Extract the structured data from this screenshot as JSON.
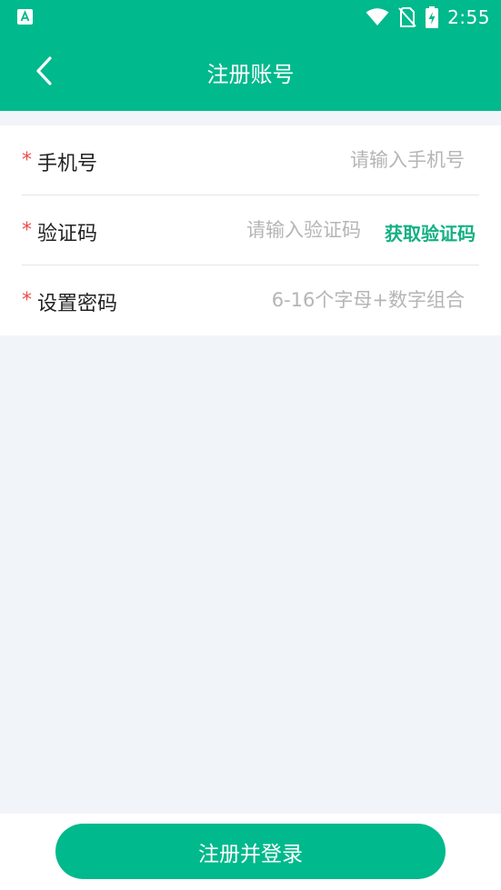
{
  "status_bar": {
    "time": "2:55",
    "icons": [
      "app-notification-icon",
      "wifi-icon",
      "no-sim-icon",
      "battery-charging-icon"
    ]
  },
  "header": {
    "title": "注册账号",
    "back_icon": "chevron-left-icon"
  },
  "form": {
    "required_mark": "*",
    "phone": {
      "label": "手机号",
      "placeholder": "请输入手机号",
      "value": ""
    },
    "code": {
      "label": "验证码",
      "placeholder": "请输入验证码",
      "value": "",
      "get_code_label": "获取验证码"
    },
    "password": {
      "label": "设置密码",
      "placeholder": "6-16个字母+数字组合",
      "value": ""
    }
  },
  "submit_label": "注册并登录",
  "colors": {
    "primary": "#00b98c",
    "required": "#ef4b4b",
    "link": "#13b082",
    "page_bg": "#f1f4f9"
  }
}
